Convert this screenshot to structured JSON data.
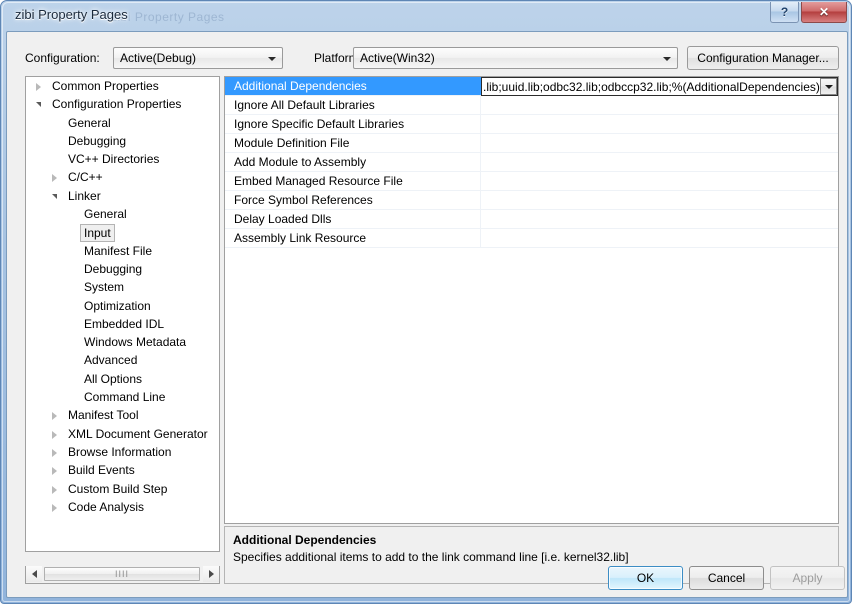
{
  "window": {
    "title": "zibi Property Pages",
    "ghost_title": "zibi Property Pages",
    "help_button": "?",
    "close_button": "✕"
  },
  "toolbar": {
    "configuration_label": "Configuration:",
    "configuration_value": "Active(Debug)",
    "platform_label": "Platform:",
    "platform_value": "Active(Win32)",
    "configuration_manager_label": "Configuration Manager..."
  },
  "tree": {
    "items": [
      {
        "label": "Common Properties",
        "indent": 0,
        "state": "collapsed"
      },
      {
        "label": "Configuration Properties",
        "indent": 0,
        "state": "expanded"
      },
      {
        "label": "General",
        "indent": 1,
        "state": "leaf"
      },
      {
        "label": "Debugging",
        "indent": 1,
        "state": "leaf"
      },
      {
        "label": "VC++ Directories",
        "indent": 1,
        "state": "leaf"
      },
      {
        "label": "C/C++",
        "indent": 1,
        "state": "collapsed"
      },
      {
        "label": "Linker",
        "indent": 1,
        "state": "expanded"
      },
      {
        "label": "General",
        "indent": 2,
        "state": "leaf"
      },
      {
        "label": "Input",
        "indent": 2,
        "state": "leaf",
        "selected": true
      },
      {
        "label": "Manifest File",
        "indent": 2,
        "state": "leaf"
      },
      {
        "label": "Debugging",
        "indent": 2,
        "state": "leaf"
      },
      {
        "label": "System",
        "indent": 2,
        "state": "leaf"
      },
      {
        "label": "Optimization",
        "indent": 2,
        "state": "leaf"
      },
      {
        "label": "Embedded IDL",
        "indent": 2,
        "state": "leaf"
      },
      {
        "label": "Windows Metadata",
        "indent": 2,
        "state": "leaf"
      },
      {
        "label": "Advanced",
        "indent": 2,
        "state": "leaf"
      },
      {
        "label": "All Options",
        "indent": 2,
        "state": "leaf"
      },
      {
        "label": "Command Line",
        "indent": 2,
        "state": "leaf"
      },
      {
        "label": "Manifest Tool",
        "indent": 1,
        "state": "collapsed"
      },
      {
        "label": "XML Document Generator",
        "indent": 1,
        "state": "collapsed"
      },
      {
        "label": "Browse Information",
        "indent": 1,
        "state": "collapsed"
      },
      {
        "label": "Build Events",
        "indent": 1,
        "state": "collapsed"
      },
      {
        "label": "Custom Build Step",
        "indent": 1,
        "state": "collapsed"
      },
      {
        "label": "Code Analysis",
        "indent": 1,
        "state": "collapsed"
      }
    ],
    "hscrollbar": {
      "left_arrow": "◄",
      "right_arrow": "►",
      "grip": "IIII"
    }
  },
  "grid": {
    "rows": [
      {
        "name": "Additional Dependencies",
        "value": "",
        "selected": true
      },
      {
        "name": "Ignore All Default Libraries",
        "value": ""
      },
      {
        "name": "Ignore Specific Default Libraries",
        "value": ""
      },
      {
        "name": "Module Definition File",
        "value": ""
      },
      {
        "name": "Add Module to Assembly",
        "value": ""
      },
      {
        "name": "Embed Managed Resource File",
        "value": ""
      },
      {
        "name": "Force Symbol References",
        "value": ""
      },
      {
        "name": "Delay Loaded Dlls",
        "value": ""
      },
      {
        "name": "Assembly Link Resource",
        "value": ""
      }
    ],
    "editor": {
      "value": ".lib;uuid.lib;odbc32.lib;odbccp32.lib;%(AdditionalDependencies)",
      "dropdown_icon": "chevron-down-icon"
    }
  },
  "description": {
    "title": "Additional Dependencies",
    "body": "Specifies additional items to add to the link command line [i.e. kernel32.lib]"
  },
  "buttons": {
    "ok": "OK",
    "cancel": "Cancel",
    "apply": "Apply"
  },
  "colors": {
    "selection": "#3399ff",
    "frame": "#5e86b5",
    "client_bg": "#f0f0f0",
    "ok_accent": "#3c8dc5"
  }
}
